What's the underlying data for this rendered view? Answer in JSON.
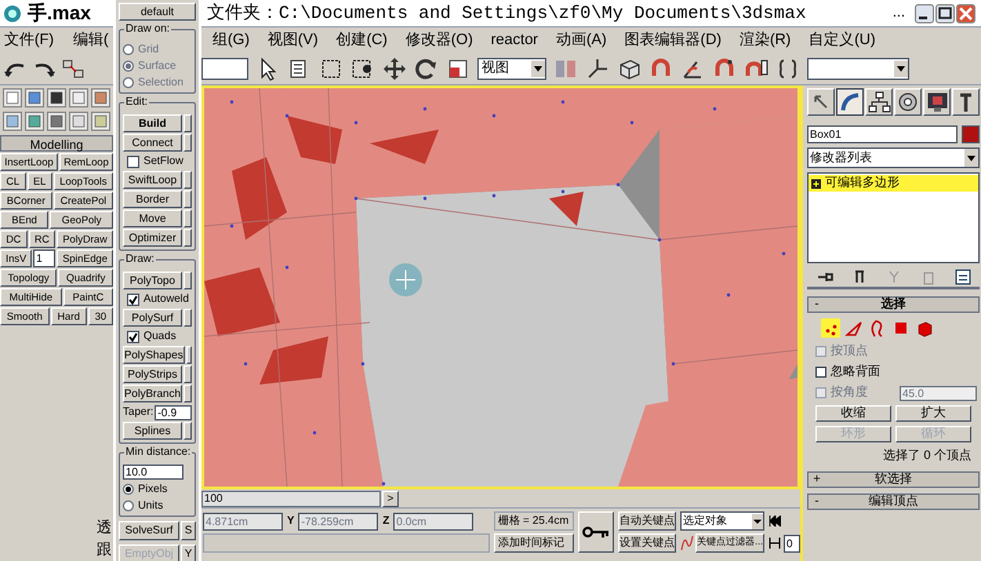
{
  "file_title": "手.max",
  "left_menu": [
    "文件(F)",
    "编辑("
  ],
  "modelling": {
    "title": "Modelling",
    "rows": [
      [
        {
          "kind": "button",
          "label": "InsertLoop"
        },
        {
          "kind": "button",
          "label": "RemLoop"
        }
      ],
      [
        {
          "kind": "button",
          "label": "CL"
        },
        {
          "kind": "button",
          "label": "EL"
        },
        {
          "kind": "button",
          "label": "LoopTools"
        }
      ],
      [
        {
          "kind": "button",
          "label": "BCorner"
        },
        {
          "kind": "button",
          "label": "CreatePol"
        }
      ],
      [
        {
          "kind": "button",
          "label": "BEnd"
        },
        {
          "kind": "button",
          "label": "GeoPoly"
        }
      ],
      [
        {
          "kind": "button",
          "label": "DC"
        },
        {
          "kind": "button",
          "label": "RC"
        },
        {
          "kind": "button",
          "label": "PolyDraw"
        }
      ],
      [
        {
          "kind": "button",
          "label": "InsV"
        },
        {
          "kind": "spinner",
          "value": "1"
        },
        {
          "kind": "button",
          "label": "SpinEdge"
        }
      ],
      [
        {
          "kind": "button",
          "label": "Topology"
        },
        {
          "kind": "button",
          "label": "Quadrify"
        }
      ],
      [
        {
          "kind": "button",
          "label": "MultiHide"
        },
        {
          "kind": "button",
          "label": "PaintC"
        }
      ],
      [
        {
          "kind": "button",
          "label": "Smooth"
        },
        {
          "kind": "button",
          "label": "Hard"
        },
        {
          "kind": "button",
          "label": "30"
        }
      ]
    ]
  },
  "left_status": [
    "透",
    "跟"
  ],
  "floating": {
    "default": "default",
    "draw_on": {
      "title": "Draw on:",
      "disabled": true,
      "options": [
        {
          "label": "Grid",
          "selected": false
        },
        {
          "label": "Surface",
          "selected": true
        },
        {
          "label": "Selection",
          "selected": false
        }
      ]
    },
    "edit": {
      "title": "Edit:",
      "items": [
        {
          "kind": "button",
          "label": "Build",
          "active": true
        },
        {
          "kind": "button",
          "label": "Connect",
          "active": false
        },
        {
          "kind": "checkbox",
          "label": "SetFlow",
          "checked": false
        },
        {
          "kind": "button",
          "label": "SwiftLoop",
          "active": false
        },
        {
          "kind": "button",
          "label": "Border",
          "active": false
        },
        {
          "kind": "button",
          "label": "Move",
          "active": false
        },
        {
          "kind": "button",
          "label": "Optimizer",
          "active": false
        }
      ]
    },
    "draw": {
      "title": "Draw:",
      "items": [
        {
          "kind": "button",
          "label": "PolyTopo",
          "active": false
        },
        {
          "kind": "checkbox",
          "label": "Autoweld",
          "checked": true
        },
        {
          "kind": "button",
          "label": "PolySurf",
          "active": false
        },
        {
          "kind": "checkbox",
          "label": "Quads",
          "checked": true
        },
        {
          "kind": "button",
          "label": "PolyShapes",
          "active": false
        },
        {
          "kind": "button",
          "label": "PolyStrips",
          "active": false
        },
        {
          "kind": "button",
          "label": "PolyBranch",
          "active": false
        },
        {
          "kind": "spinner",
          "label": "Taper:",
          "value": "-0.9"
        },
        {
          "kind": "button",
          "label": "Splines",
          "active": false
        }
      ]
    },
    "min_distance": {
      "title": "Min distance:",
      "value": "10.0",
      "options": [
        {
          "label": "Pixels",
          "selected": true
        },
        {
          "label": "Units",
          "selected": false
        }
      ]
    },
    "footer": [
      {
        "label": "SolveSurf",
        "side": "S",
        "disabled": false
      },
      {
        "label": "EmptyObj",
        "side": "Y",
        "disabled": true
      }
    ]
  },
  "window": {
    "title": "文件夹：C:\\Documents and Settings\\zf0\\My Documents\\3dsmax",
    "ellipsis": "..."
  },
  "menu": [
    "组(G)",
    "视图(V)",
    "创建(C)",
    "修改器(O)",
    "reactor",
    "动画(A)",
    "图表编辑器(D)",
    "渲染(R)",
    "自定义(U)"
  ],
  "toolbar": {
    "view_dropdown": "视图"
  },
  "right_panel": {
    "tabs": [
      {
        "kind": "create",
        "selected": false
      },
      {
        "kind": "modify",
        "selected": true
      },
      {
        "kind": "hierarchy",
        "selected": false
      },
      {
        "kind": "motion",
        "selected": false
      },
      {
        "kind": "display",
        "selected": false
      },
      {
        "kind": "utilities",
        "selected": false
      }
    ],
    "object_name": "Box01",
    "modifier_list": "修改器列表",
    "stack": [
      {
        "label": "可编辑多边形",
        "selected": true
      }
    ],
    "selection": {
      "sign": "-",
      "title": "选择",
      "subobjects": [
        {
          "kind": "vertex",
          "selected": true
        },
        {
          "kind": "edge",
          "selected": false
        },
        {
          "kind": "border",
          "selected": false
        },
        {
          "kind": "polygon",
          "selected": false
        },
        {
          "kind": "element",
          "selected": false
        }
      ],
      "checks": [
        {
          "label": "按顶点",
          "checked": false,
          "disabled": true
        },
        {
          "label": "忽略背面",
          "checked": false,
          "disabled": false
        },
        {
          "label": "按角度",
          "checked": false,
          "disabled": true,
          "value": "45.0"
        }
      ],
      "buttons": [
        {
          "label": "收缩",
          "disabled": false
        },
        {
          "label": "扩大",
          "disabled": false
        },
        {
          "label": "环形",
          "disabled": true
        },
        {
          "label": "循环",
          "disabled": true
        }
      ],
      "status": "选择了 0 个顶点"
    },
    "rollouts": [
      {
        "sign": "+",
        "title": "软选择"
      },
      {
        "sign": "-",
        "title": "编辑顶点"
      }
    ]
  },
  "bottom": {
    "timeline": {
      "value": "100",
      "arrow": ">"
    },
    "coords": [
      {
        "value": "4.871cm",
        "disabled": true
      },
      {
        "axis": "Y",
        "value": "-78.259cm",
        "disabled": true
      },
      {
        "axis": "Z",
        "value": "0.0cm",
        "disabled": true
      }
    ],
    "grid": "栅格 = 25.4cm",
    "add_time_tag": "添加时间标记",
    "auto_key": "自动关键点",
    "set_key": "设置关键点",
    "key_mode": "选定对象",
    "key_filters": "关键点过滤器...",
    "frame": "0"
  }
}
